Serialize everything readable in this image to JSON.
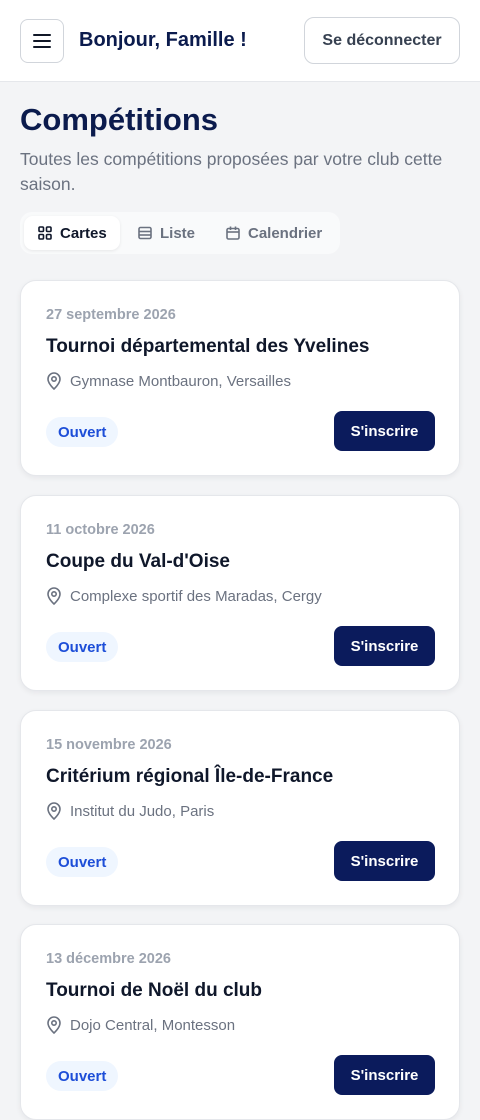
{
  "header": {
    "greeting": "Bonjour, Famille !",
    "logout_label": "Se déconnecter",
    "menu_icon": "hamburger-icon"
  },
  "page": {
    "title": "Compétitions",
    "subtitle": "Toutes les compétitions proposées par votre club cette saison."
  },
  "view_tabs": [
    {
      "label": "Cartes",
      "icon": "grid-icon",
      "active": true
    },
    {
      "label": "Liste",
      "icon": "list-icon",
      "active": false
    },
    {
      "label": "Calendrier",
      "icon": "calendar-icon",
      "active": false
    }
  ],
  "competitions": [
    {
      "date": "27 septembre 2026",
      "title": "Tournoi départemental des Yvelines",
      "location": "Gymnase Montbauron, Versailles",
      "status": "Ouvert",
      "action": "S'inscrire"
    },
    {
      "date": "11 octobre 2026",
      "title": "Coupe du Val-d'Oise",
      "location": "Complexe sportif des Maradas, Cergy",
      "status": "Ouvert",
      "action": "S'inscrire"
    },
    {
      "date": "15 novembre 2026",
      "title": "Critérium régional Île-de-France",
      "location": "Institut du Judo, Paris",
      "status": "Ouvert",
      "action": "S'inscrire"
    },
    {
      "date": "13 décembre 2026",
      "title": "Tournoi de Noël du club",
      "location": "Dojo Central, Montesson",
      "status": "Ouvert",
      "action": "S'inscrire"
    }
  ],
  "colors": {
    "primary": "#0b1b5c",
    "badge_bg": "#eff6ff",
    "badge_text": "#1d4ed8",
    "page_bg": "#f3f4f6"
  }
}
